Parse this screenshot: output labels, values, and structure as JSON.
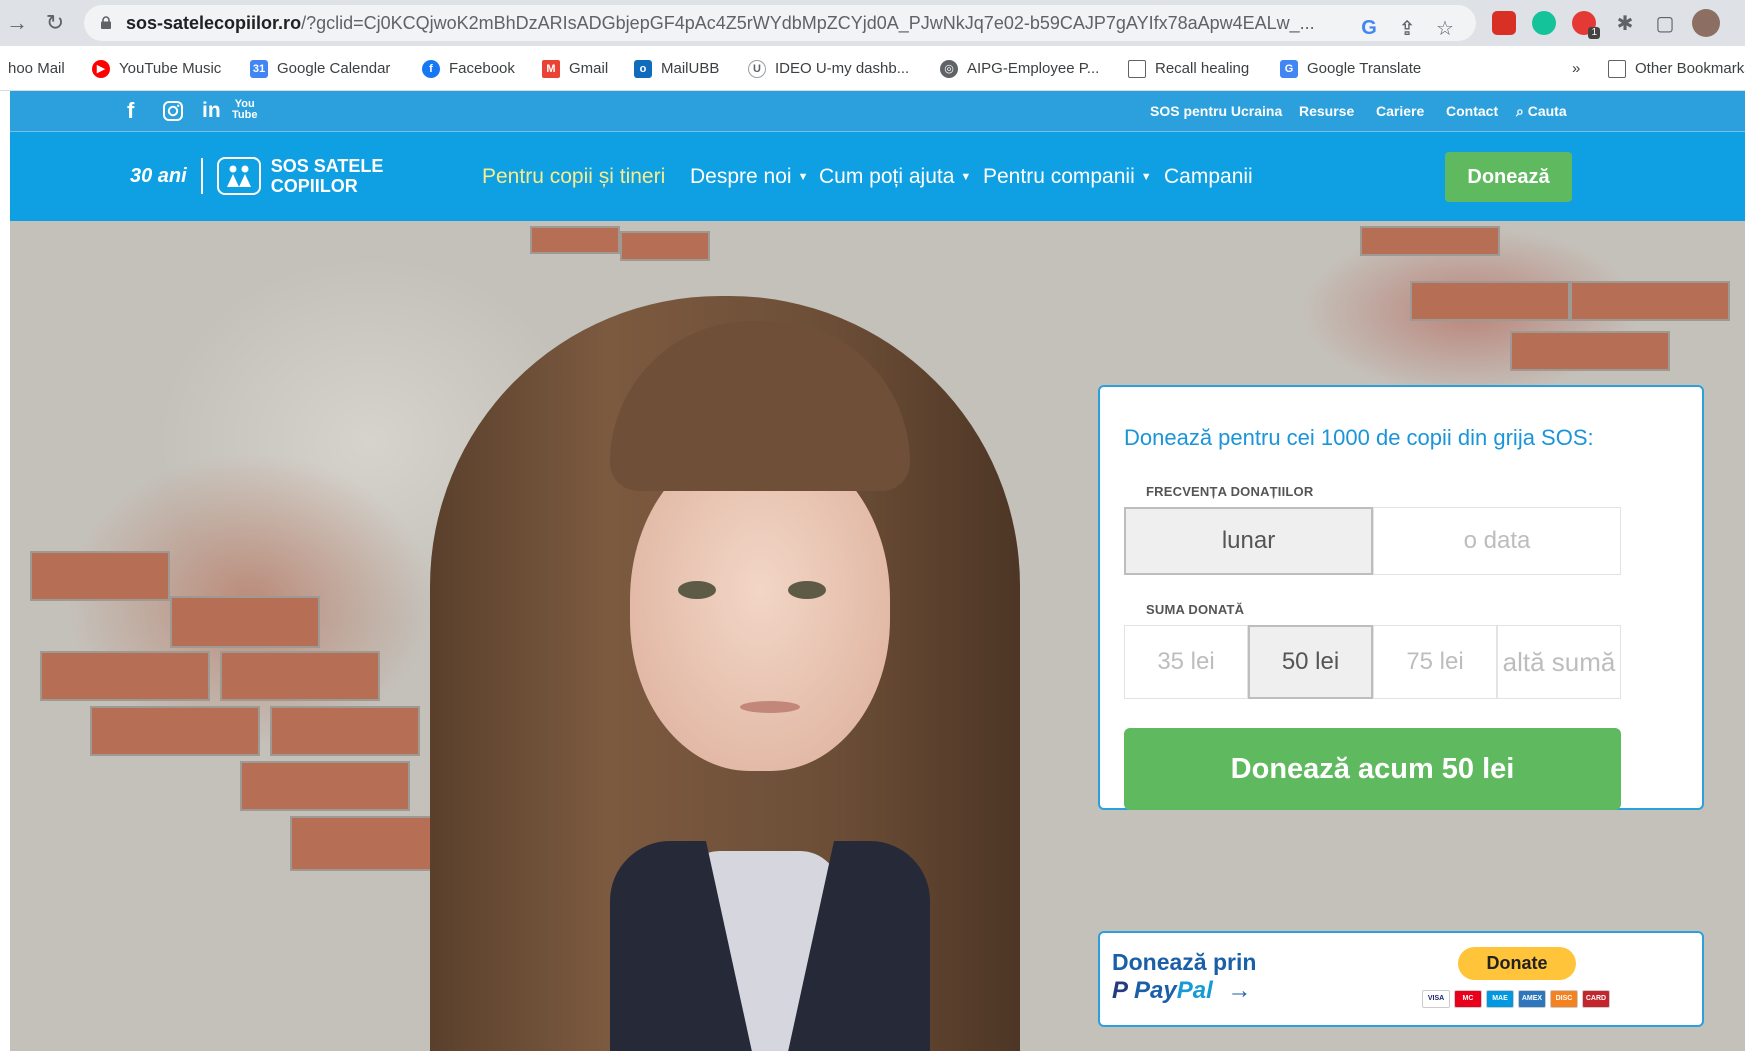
{
  "browser": {
    "url_host": "sos-satelecopiilor.ro",
    "url_rest": "/?gclid=Cj0KCQjwoK2mBhDzARIsADGbjepGF4pAc4Z5rWYdbMpZCYjd0A_PJwNkJq7e02-b59CAJP7gAYIfx78aApw4EALw_...",
    "extension_badge": "1",
    "bookmarks": [
      {
        "label": "hoo Mail",
        "icon": "yahoo-mail-icon"
      },
      {
        "label": "YouTube Music",
        "icon": "youtube-music-icon",
        "color": "#ff0000"
      },
      {
        "label": "Google Calendar",
        "icon": "google-calendar-icon",
        "color": "#4285f4"
      },
      {
        "label": "Facebook",
        "icon": "facebook-icon",
        "color": "#1877f2"
      },
      {
        "label": "Gmail",
        "icon": "gmail-icon",
        "color": "#ea4335"
      },
      {
        "label": "MailUBB",
        "icon": "outlook-icon",
        "color": "#0f6cbd"
      },
      {
        "label": "IDEO U-my dashb...",
        "icon": "ideo-icon"
      },
      {
        "label": "AIPG-Employee P...",
        "icon": "globe-icon"
      },
      {
        "label": "Recall healing",
        "icon": "folder-icon"
      },
      {
        "label": "Google Translate",
        "icon": "google-translate-icon",
        "color": "#4285f4"
      }
    ],
    "more_bookmarks": "»",
    "other_bookmarks": "Other Bookmarks"
  },
  "topbar": {
    "links": [
      "SOS pentru Ucraina",
      "Resurse",
      "Cariere",
      "Contact"
    ],
    "search_label": "Cauta",
    "social_icons": [
      "facebook-icon",
      "instagram-icon",
      "linkedin-icon",
      "youtube-icon"
    ]
  },
  "nav": {
    "logo_30": "30 ani",
    "logo_name_line1": "SOS SATELE",
    "logo_name_line2": "COPIILOR",
    "items": [
      {
        "label": "Pentru copii și tineri",
        "active": true
      },
      {
        "label": "Despre noi",
        "dropdown": true
      },
      {
        "label": "Cum poți ajuta",
        "dropdown": true
      },
      {
        "label": "Pentru companii",
        "dropdown": true
      },
      {
        "label": "Campanii"
      }
    ],
    "donate": "Donează",
    "colors": {
      "bar": "#0ea0e2",
      "active": "#f7ec8f",
      "donate": "#5fba5f"
    }
  },
  "donation": {
    "title": "Donează pentru cei 1000 de copii din grija SOS:",
    "frequency_label": "FRECVENȚA DONAȚIILOR",
    "frequency_options": [
      "lunar",
      "o data"
    ],
    "frequency_selected": "lunar",
    "amount_label": "SUMA DONATĂ",
    "amount_options": [
      "35 lei",
      "50 lei",
      "75 lei",
      "altă sumă"
    ],
    "amount_selected": "50 lei",
    "cta": "Donează acum 50 lei"
  },
  "paypal": {
    "title": "Donează prin",
    "logo_pay": "Pay",
    "logo_pal": "Pal",
    "arrow": "→",
    "button": "Donate",
    "cards": [
      "VISA",
      "MC",
      "MAE",
      "AMEX",
      "DISC",
      "CARD"
    ]
  }
}
